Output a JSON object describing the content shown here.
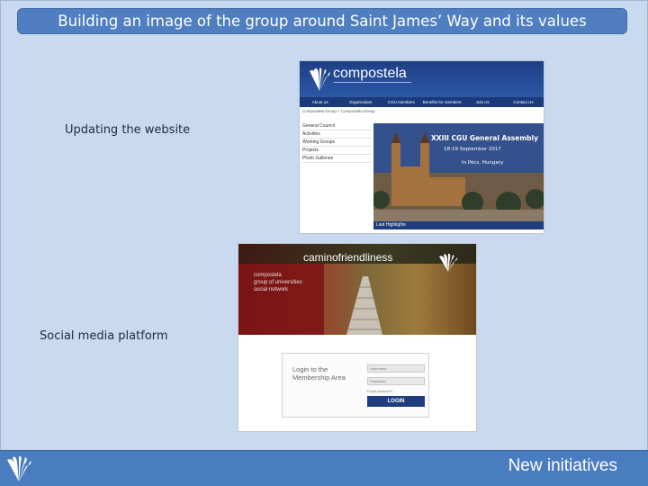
{
  "slide": {
    "title": "Building an image of the group around Saint James’ Way and its values",
    "footer_label": "New initiatives"
  },
  "captions": {
    "website": "Updating the website",
    "social": "Social media platform"
  },
  "website_screenshot": {
    "brand": "compostela",
    "nav": [
      "About us",
      "Organization",
      "CGU members",
      "Benefits for members",
      "Join Us",
      "Contact Us"
    ],
    "breadcrumb": "Compostela Group  »  Compostela Group",
    "sidebar": [
      "General Council",
      "Activities",
      "Working Groups",
      "Projects",
      "Photo Galleries"
    ],
    "banner": {
      "title": "XXIII CGU General Assembly",
      "date": "18-19 September 2017",
      "place": "In Pécs, Hungary"
    },
    "highlights_label": "Last Highlights"
  },
  "social_screenshot": {
    "brand": "caminofriendliness",
    "tagline": [
      "compostela",
      "group of universities",
      "social network"
    ],
    "login_title": [
      "Login to the",
      "Membership Area"
    ],
    "username_placeholder": "Username",
    "password_placeholder": "Password",
    "forgot_text": "Forgot password?",
    "login_button": "LOGIN"
  },
  "colors": {
    "background": "#c9d9ef",
    "title_bar": "#4f7fc0",
    "footer_bar": "#4a7cc0",
    "website_header": "#1e3f86"
  }
}
